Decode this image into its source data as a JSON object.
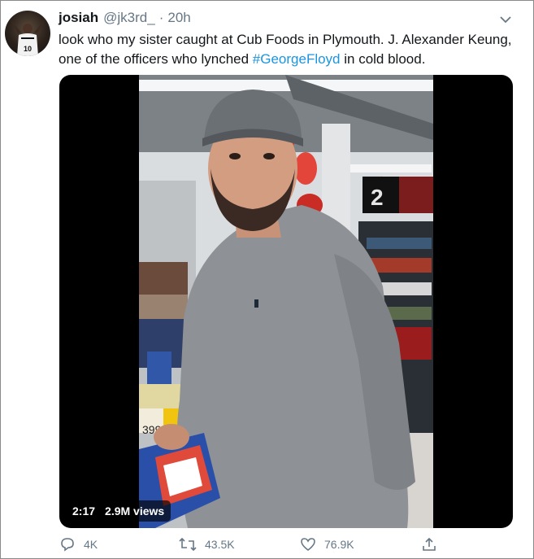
{
  "tweet": {
    "display_name": "josiah",
    "handle": "@jk3rd_",
    "separator": "·",
    "time": "20h",
    "text_before": "look who my sister caught at Cub Foods in Plymouth. J. Alexander Keung, one of the officers who lynched ",
    "hashtag": "#GeorgeFloyd",
    "text_after": " in cold blood."
  },
  "video": {
    "duration": "2:17",
    "views": "2.9M views",
    "price_tag": "399"
  },
  "actions": {
    "replies": "4K",
    "retweets": "43.5K",
    "likes": "76.9K"
  },
  "colors": {
    "link": "#1b95e0",
    "secondary_text": "#657786"
  },
  "icons": [
    "avatar",
    "caret-down-icon",
    "reply-icon",
    "retweet-icon",
    "like-icon",
    "share-icon"
  ]
}
